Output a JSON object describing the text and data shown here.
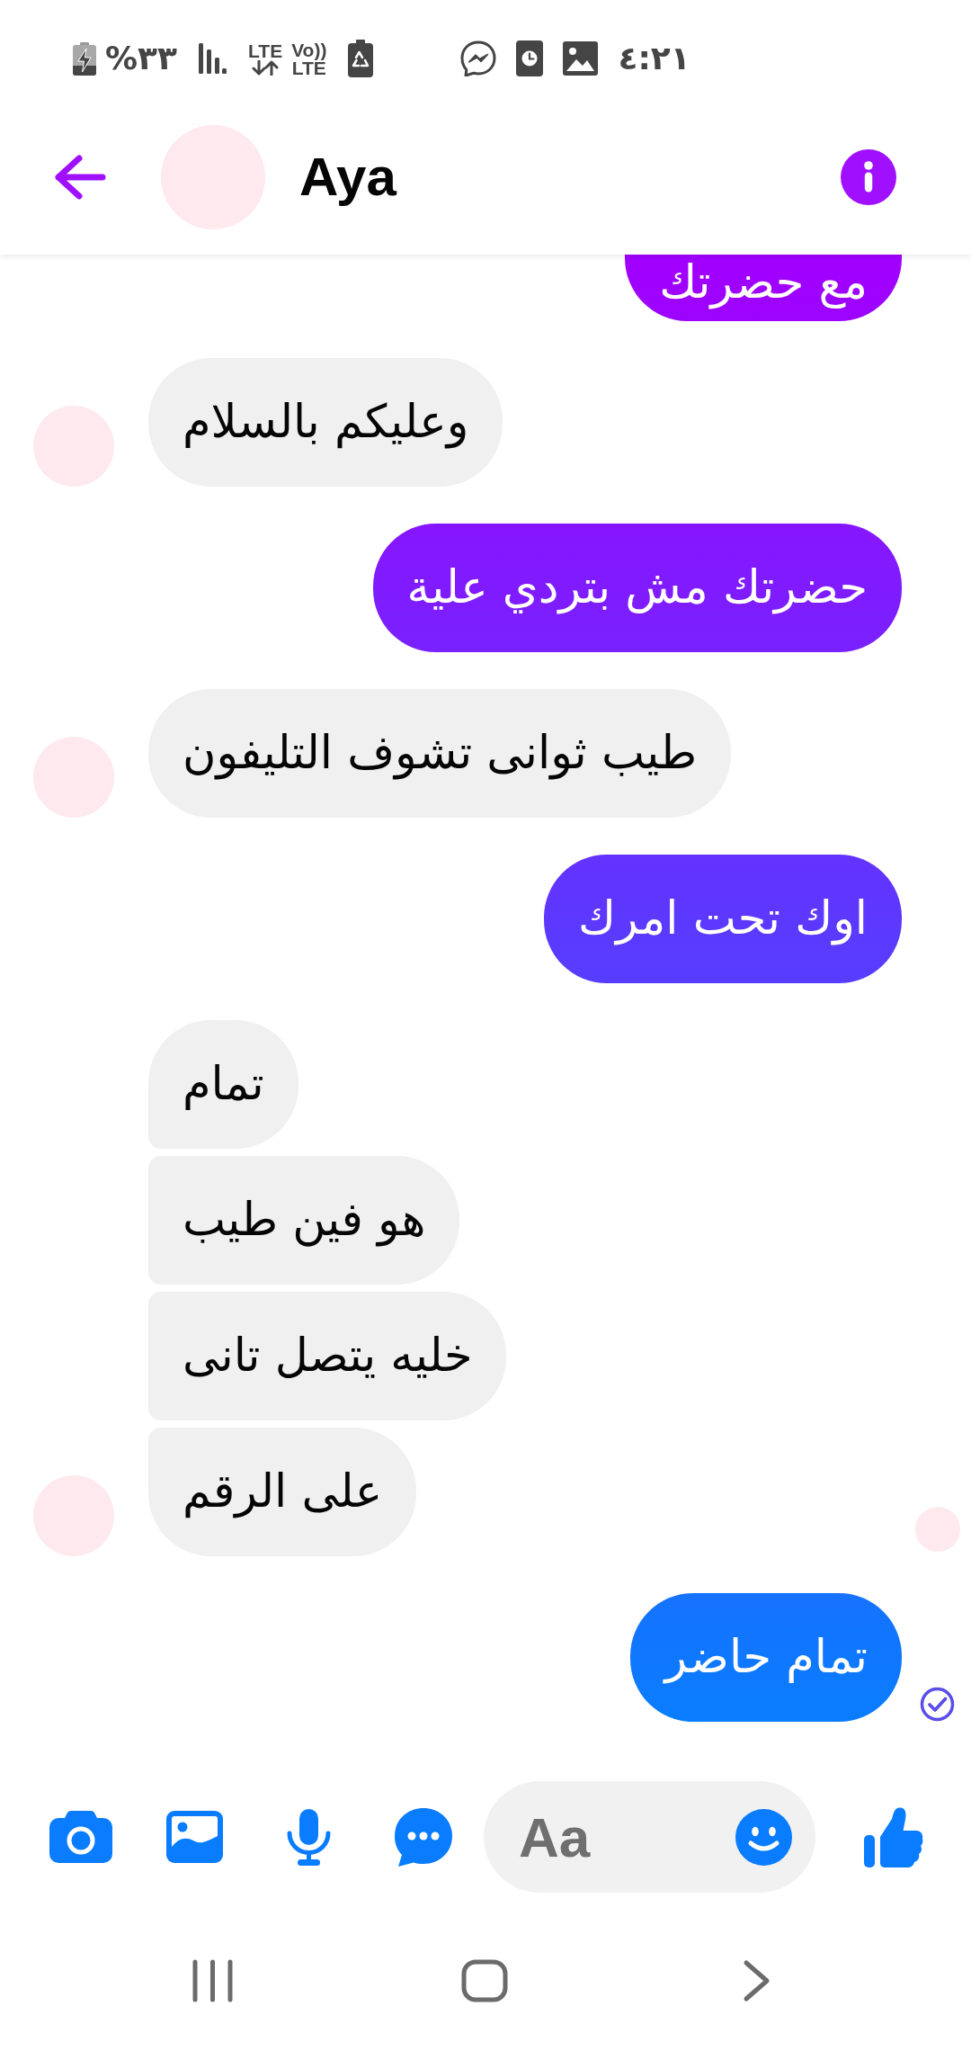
{
  "status_bar": {
    "battery_text": "%٣٣",
    "network_label": "LTE",
    "volte_top": "Vo))",
    "volte_bottom": "LTE",
    "time": "٤:٢١"
  },
  "header": {
    "title": "Aya"
  },
  "conversation": [
    {
      "kind": "sent",
      "seen_marker": false,
      "delivered": false,
      "messages": [
        {
          "text": "مع حضرتك"
        }
      ]
    },
    {
      "kind": "received",
      "seen_marker": false,
      "delivered": false,
      "messages": [
        {
          "text": "وعليكم بالسلام"
        }
      ]
    },
    {
      "kind": "sent",
      "seen_marker": false,
      "delivered": false,
      "messages": [
        {
          "text": "حضرتك مش بتردي علية"
        }
      ]
    },
    {
      "kind": "received",
      "seen_marker": false,
      "delivered": false,
      "messages": [
        {
          "text": "طيب ثوانى تشوف التليفون"
        }
      ]
    },
    {
      "kind": "sent",
      "seen_marker": false,
      "delivered": false,
      "messages": [
        {
          "text": "اوك تحت امرك"
        }
      ]
    },
    {
      "kind": "received",
      "seen_marker": true,
      "delivered": false,
      "messages": [
        {
          "text": "تمام"
        },
        {
          "text": "هو فين طيب"
        },
        {
          "text": "خليه يتصل تانى"
        },
        {
          "text": "على الرقم"
        }
      ]
    },
    {
      "kind": "sent",
      "seen_marker": false,
      "delivered": true,
      "messages": [
        {
          "text": "تمام حاضر"
        }
      ]
    }
  ],
  "composer": {
    "placeholder": "Aa"
  }
}
